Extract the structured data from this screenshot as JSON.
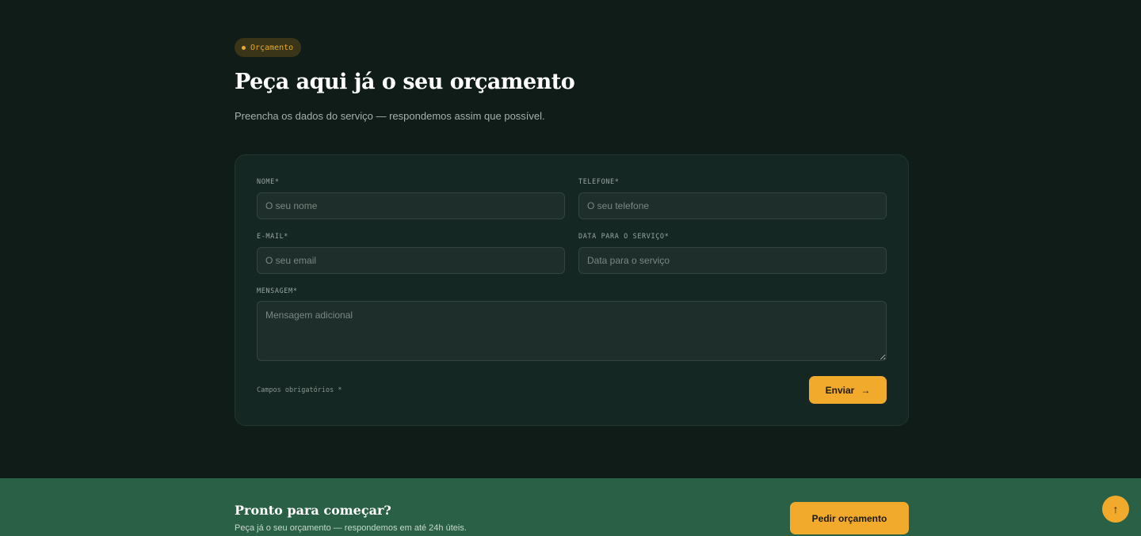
{
  "badge": {
    "label": "Orçamento",
    "icon": "dot-icon"
  },
  "header": {
    "title": "Peça aqui já o seu orçamento",
    "subtitle": "Preencha os dados do serviço — respondemos assim que possível."
  },
  "form": {
    "name": {
      "label": "NOME*",
      "placeholder": "O seu nome"
    },
    "phone": {
      "label": "TELEFONE*",
      "placeholder": "O seu telefone"
    },
    "email": {
      "label": "E-MAIL*",
      "placeholder": "O seu email"
    },
    "date": {
      "label": "DATA PARA O SERVIÇO*",
      "placeholder": "Data para o serviço"
    },
    "message": {
      "label": "MENSAGEM*",
      "placeholder": "Mensagem adicional"
    },
    "required_note": "Campos obrigatórios *",
    "submit_label": "Enviar",
    "submit_icon": "→"
  },
  "cta": {
    "title": "Pronto para começar?",
    "subtitle": "Peça já o seu orçamento — respondemos em até 24h úteis.",
    "button_label": "Pedir orçamento"
  },
  "scroll_top": {
    "icon": "↑"
  },
  "colors": {
    "background": "#0f1c18",
    "card": "#142722",
    "accent": "#f1aa2c",
    "cta_band": "#2a6045"
  }
}
